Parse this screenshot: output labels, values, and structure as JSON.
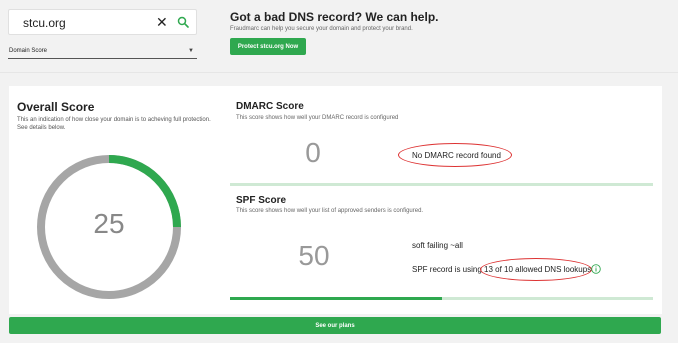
{
  "search": {
    "value": "stcu.org",
    "clear_icon": "close-icon",
    "search_icon": "search-icon"
  },
  "select": {
    "value": "Domain Score",
    "arrow_icon": "caret-down-icon"
  },
  "promo": {
    "title": "Got a bad DNS record? We can help.",
    "subtitle": "Fraudmarc can help you secure your domain and protect your brand.",
    "button_label": "Protect stcu.org Now"
  },
  "overall": {
    "title": "Overall Score",
    "description": "This an indication of how close your domain is to acheving full protection. See details below.",
    "score": "25",
    "score_fraction": 0.25
  },
  "dmarc": {
    "title": "DMARC Score",
    "description": "This score shows how well your DMARC record is configured",
    "score": "0",
    "status": "No DMARC record found",
    "bar_fraction": 0
  },
  "spf": {
    "title": "SPF Score",
    "description": "This score shows how well your list of approved senders is configured.",
    "score": "50",
    "status": "soft failing ~all",
    "lookups_text": "SPF record is using 13 of 10 allowed DNS lookups",
    "info_icon": "info-icon",
    "bar_fraction": 0.5
  },
  "plans_button_label": "See our plans",
  "colors": {
    "accent": "#2fa84f",
    "track": "#a6a6a6",
    "annotation": "#dd3333",
    "bar_track": "#cfe9d4"
  }
}
